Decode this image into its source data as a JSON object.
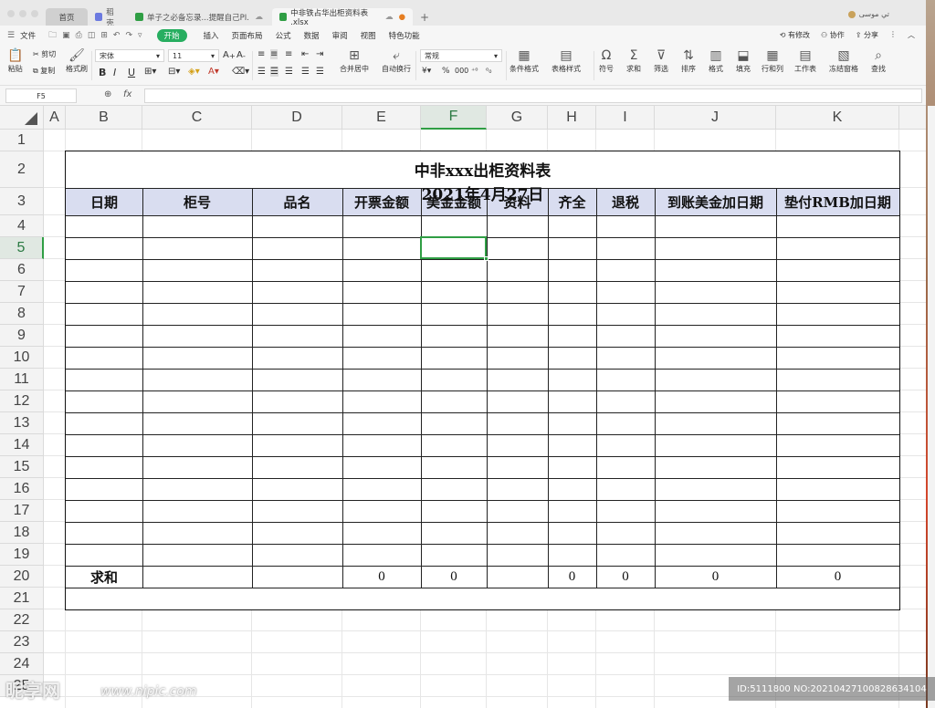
{
  "tabs": {
    "home": "首页",
    "t2": "稻壳",
    "t3": "单子之必备忘录...提醒自己PI.",
    "t4": "中非铁占华出柜资料表 .xlsx",
    "plus": "+",
    "user": "تي موسى"
  },
  "menu": {
    "file": "文件",
    "start": "开始",
    "items": [
      "插入",
      "页面布局",
      "公式",
      "数据",
      "审阅",
      "视图",
      "特色功能"
    ],
    "right": [
      "有修改",
      "协作",
      "分享"
    ]
  },
  "toolbar": {
    "paste": "粘贴",
    "cut": "剪切",
    "copy": "复制",
    "format_painter": "格式刷",
    "font_name": "宋体",
    "font_size": "11",
    "merge": "合并居中",
    "wrap": "自动换行",
    "number_format": "常规",
    "cond_format": "条件格式",
    "table_style": "表格样式",
    "symbol": "符号",
    "sum": "求和",
    "filter": "筛选",
    "sort": "排序",
    "format": "格式",
    "fill": "填充",
    "rowcol": "行和列",
    "sheet": "工作表",
    "freeze": "冻结窗格",
    "find": "查找"
  },
  "formula_bar": {
    "cell_ref": "F5",
    "fx": "fx",
    "value": ""
  },
  "columns": [
    "A",
    "B",
    "C",
    "D",
    "E",
    "F",
    "G",
    "H",
    "I",
    "J",
    "K"
  ],
  "rows": [
    "1",
    "2",
    "3",
    "4",
    "5",
    "6",
    "7",
    "8",
    "9",
    "10",
    "11",
    "12",
    "13",
    "14",
    "15",
    "16",
    "17",
    "18",
    "19",
    "20",
    "21",
    "22",
    "23",
    "24",
    "25"
  ],
  "selected_cell": "F5",
  "sheet": {
    "title": "中非xxx出柜资料表",
    "date": "2021年4月27日",
    "headers": [
      "日期",
      "柜号",
      "品名",
      "开票金额",
      "美金金额",
      "资料",
      "齐全",
      "退税",
      "到账美金加日期",
      "垫付RMB加日期"
    ],
    "sum_label": "求和",
    "sum_values": [
      "",
      "",
      "0",
      "0",
      "",
      "0",
      "0",
      "0",
      "0"
    ]
  },
  "watermark": {
    "logo": "昵享网",
    "url": "www.nipic.com",
    "id": "ID:5111800 NO:20210427100828634104"
  }
}
